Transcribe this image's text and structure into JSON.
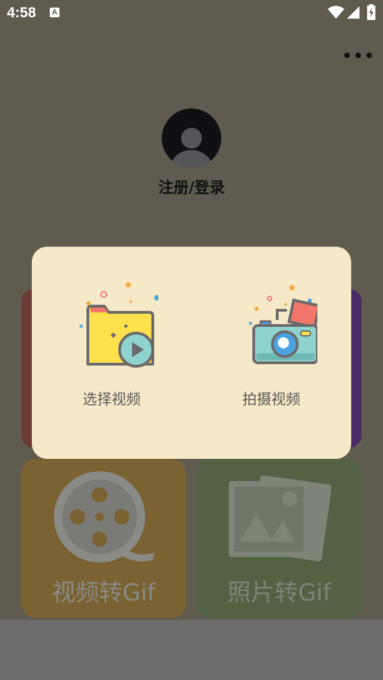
{
  "status_bar": {
    "time": "4:58",
    "notification_icon_letter": "A"
  },
  "profile": {
    "login_label": "注册/登录"
  },
  "tiles": [
    {
      "label": "视频转Gif",
      "icon": "film-reel-icon"
    },
    {
      "label": "照片转Gif",
      "icon": "photo-stack-icon"
    }
  ],
  "dialog": {
    "options": [
      {
        "label": "选择视频",
        "icon": "video-folder-icon"
      },
      {
        "label": "拍摄视频",
        "icon": "camera-icon"
      }
    ]
  },
  "colors": {
    "background": "#5f5b4f",
    "dialog_bg": "#f6e9c8",
    "tile_video": "#7a6232",
    "tile_photo": "#526243",
    "card_left": "#6a3a33",
    "card_right": "#4a2b66"
  }
}
